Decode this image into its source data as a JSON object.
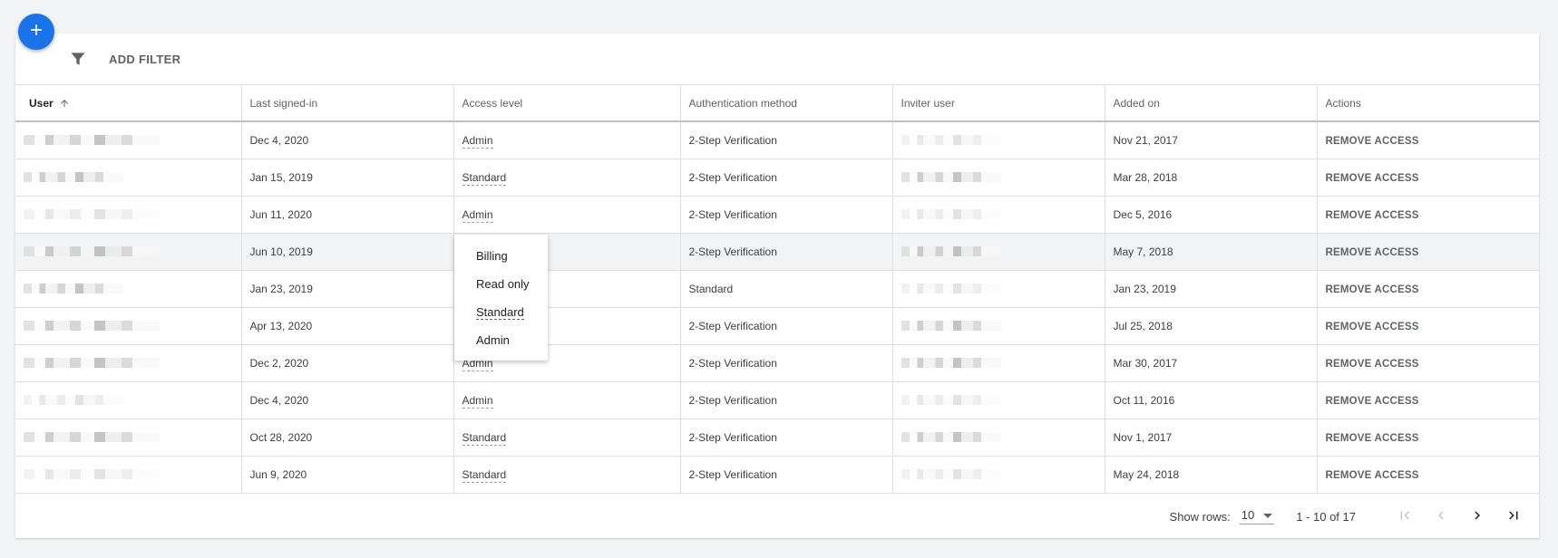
{
  "toolbar": {
    "add_filter": "ADD FILTER"
  },
  "table": {
    "headers": [
      "User",
      "Last signed-in",
      "Access level",
      "Authentication method",
      "Inviter user",
      "Added on",
      "Actions"
    ],
    "rows": [
      {
        "last": "Dec 4, 2020",
        "access": "Admin",
        "auth": "2-Step Verification",
        "added": "Nov 21, 2017",
        "action": "REMOVE ACCESS"
      },
      {
        "last": "Jan 15, 2019",
        "access": "Standard",
        "auth": "2-Step Verification",
        "added": "Mar 28, 2018",
        "action": "REMOVE ACCESS"
      },
      {
        "last": "Jun 11, 2020",
        "access": "Admin",
        "auth": "2-Step Verification",
        "added": "Dec 5, 2016",
        "action": "REMOVE ACCESS"
      },
      {
        "last": "Jun 10, 2019",
        "access": "",
        "auth": "2-Step Verification",
        "added": "May 7, 2018",
        "action": "REMOVE ACCESS"
      },
      {
        "last": "Jan 23, 2019",
        "access": "",
        "auth": "Standard",
        "added": "Jan 23, 2019",
        "action": "REMOVE ACCESS"
      },
      {
        "last": "Apr 13, 2020",
        "access": "",
        "auth": "2-Step Verification",
        "added": "Jul 25, 2018",
        "action": "REMOVE ACCESS"
      },
      {
        "last": "Dec 2, 2020",
        "access": "Admin",
        "auth": "2-Step Verification",
        "added": "Mar 30, 2017",
        "action": "REMOVE ACCESS"
      },
      {
        "last": "Dec 4, 2020",
        "access": "Admin",
        "auth": "2-Step Verification",
        "added": "Oct 11, 2016",
        "action": "REMOVE ACCESS"
      },
      {
        "last": "Oct 28, 2020",
        "access": "Standard",
        "auth": "2-Step Verification",
        "added": "Nov 1, 2017",
        "action": "REMOVE ACCESS"
      },
      {
        "last": "Jun 9, 2020",
        "access": "Standard",
        "auth": "2-Step Verification",
        "added": "May 24, 2018",
        "action": "REMOVE ACCESS"
      }
    ]
  },
  "menu": {
    "items": [
      "Billing",
      "Read only",
      "Standard",
      "Admin"
    ],
    "selected": "Standard"
  },
  "footer": {
    "show_rows_label": "Show rows:",
    "rows_value": "10",
    "range": "1 - 10 of 17"
  },
  "colors": {
    "accent": "#1a73e8"
  },
  "icons": {
    "fab": "plus-icon",
    "filter": "filter-icon",
    "sort": "arrow-up-icon",
    "first": "first-page-icon",
    "prev": "chevron-left-icon",
    "next": "chevron-right-icon",
    "last": "last-page-icon"
  }
}
